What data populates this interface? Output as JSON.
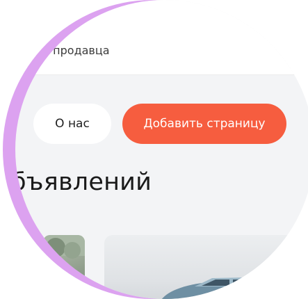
{
  "header": {
    "seller_text": "м продавца"
  },
  "actions": {
    "about_label": "О нас",
    "add_page_label": "Добавить страницу"
  },
  "section": {
    "title": "бъявлений"
  },
  "colors": {
    "accent": "#f65d3f",
    "ring": "#dca2f0",
    "page_bg": "#f3f4f6"
  },
  "icons": {
    "listing_image_left": "photo-thumbnail",
    "listing_image_main": "car-photo"
  }
}
